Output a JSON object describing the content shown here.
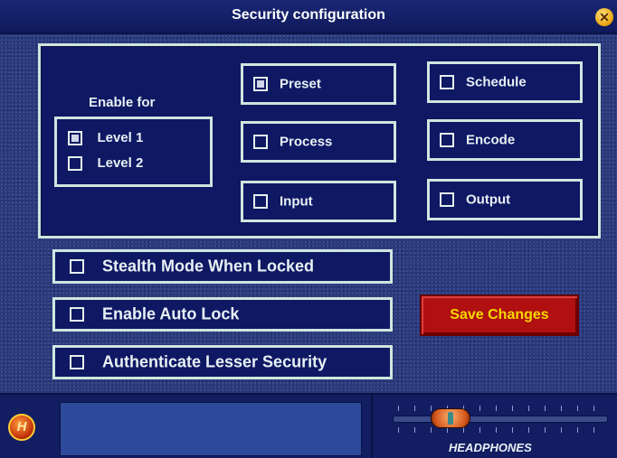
{
  "window": {
    "title": "Security configuration"
  },
  "enable_for": {
    "heading": "Enable for",
    "levels": [
      {
        "label": "Level 1",
        "checked": true
      },
      {
        "label": "Level 2",
        "checked": false
      }
    ]
  },
  "options": [
    {
      "label": "Preset",
      "checked": true
    },
    {
      "label": "Process",
      "checked": false
    },
    {
      "label": "Input",
      "checked": false
    },
    {
      "label": "Schedule",
      "checked": false
    },
    {
      "label": "Encode",
      "checked": false
    },
    {
      "label": "Output",
      "checked": false
    }
  ],
  "settings": [
    {
      "label": "Stealth Mode When Locked",
      "checked": false
    },
    {
      "label": "Enable Auto Lock",
      "checked": false
    },
    {
      "label": "Authenticate Lesser Security",
      "checked": false
    }
  ],
  "save_button": {
    "label": "Save Changes"
  },
  "footer": {
    "logo_letter": "H",
    "slider_label": "HEADPHONES"
  },
  "colors": {
    "save_bg": "#b01010",
    "save_text": "#f5d800",
    "border": "#cfe6df",
    "panel": "#0e1863"
  }
}
